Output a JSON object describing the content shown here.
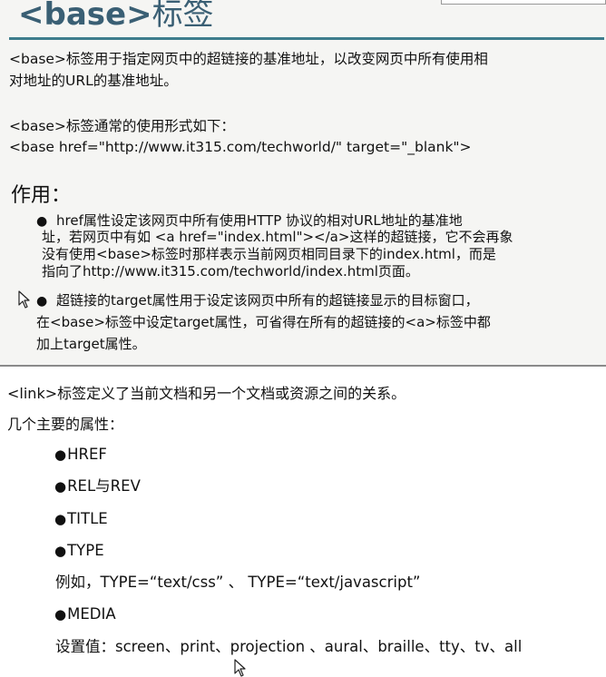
{
  "title": {
    "tag": "<base>",
    "rest": "标签"
  },
  "intro": {
    "line1": "<base>标签用于指定网页中的超链接的基准地址，以改变网页中所有使用相",
    "line2": "对地址的URL的基准地址。"
  },
  "usage": {
    "line1": "<base>标签通常的使用形式如下：",
    "code": "<base href=\"http://www.it315.com/techworld/\" target=\"_blank\">"
  },
  "heading": "作用：",
  "bullets": [
    {
      "symbol": "●",
      "lines": [
        "href属性设定该网页中所有使用HTTP 协议的相对URL地址的基准地",
        "址，若网页中有如 <a href=\"index.html\"></a>这样的超链接，它不会再象",
        "没有使用<base>标签时那样表示当前网页相同目录下的index.html，而是",
        "指向了http://www.it315.com/techworld/index.html页面。"
      ]
    },
    {
      "symbol": "●",
      "lines": [
        "超链接的target属性用于设定该网页中所有的超链接显示的目标窗口，",
        "在<base>标签中设定target属性，可省得在所有的超链接的<a>标签中都",
        "加上target属性。"
      ]
    }
  ],
  "link": {
    "line1": "<link>标签定义了当前文档和另一个文档或资源之间的关系。",
    "line2": "几个主要的属性：",
    "items": [
      {
        "dot": "●",
        "label": "HREF"
      },
      {
        "dot": "●",
        "label": "REL与REV"
      },
      {
        "dot": "●",
        "label": "TITLE"
      },
      {
        "dot": "●",
        "label": "TYPE"
      },
      {
        "dot": "",
        "label": "例如，TYPE=“text/css” 、 TYPE=“text/javascript”"
      },
      {
        "dot": "●",
        "label": "MEDIA"
      },
      {
        "dot": "",
        "label": "设置值：screen、print、projection 、aural、braille、tty、tv、all"
      }
    ]
  },
  "colors": {
    "title": "#3a5f74",
    "rule": "#3e7d8c",
    "panel_bg": "#f5f5f3"
  },
  "icons": [
    "mouse-pointer-icon",
    "mouse-pointer-icon"
  ]
}
